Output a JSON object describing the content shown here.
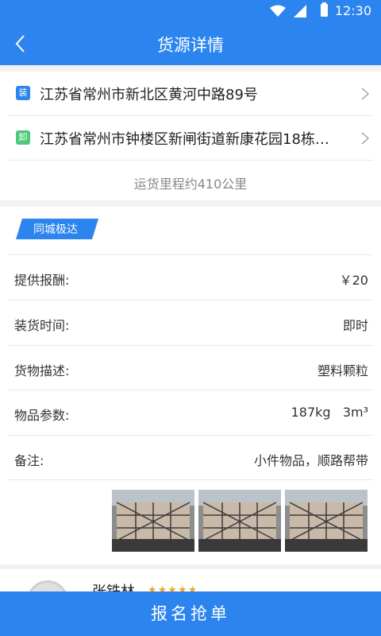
{
  "status_bar": {
    "time": "12:30",
    "icons": [
      "wifi-icon",
      "signal-icon",
      "battery-icon"
    ]
  },
  "header": {
    "title": "货源详情",
    "back_icon": "chevron-left-icon"
  },
  "route": {
    "load_tag": "装",
    "load_tag_color": "#2c84ee",
    "load_address": "江苏省常州市新北区黄河中路89号",
    "unload_tag": "卸",
    "unload_tag_color": "#4cc97a",
    "unload_address": "江苏省常州市钟楼区新闸街道新康花园18栋…",
    "mileage": "运货里程约410公里"
  },
  "detail": {
    "badge": "同城极达",
    "rows": [
      {
        "label": "提供报酬:",
        "value": "￥20"
      },
      {
        "label": "装货时间:",
        "value": "即时"
      },
      {
        "label": "货物描述:",
        "value": "塑料颗粒"
      },
      {
        "label": "物品参数:",
        "value": "187kg   3m³"
      },
      {
        "label": "备注:",
        "value": "小件物品，顺路帮带"
      }
    ],
    "photos": [
      "cargo-photo",
      "cargo-photo",
      "cargo-photo"
    ]
  },
  "shipper": {
    "name": "张铁林",
    "stars": "★★★★★"
  },
  "actions": {
    "submit_label": "报名抢单"
  },
  "colors": {
    "primary": "#2c84ee",
    "star": "#f5a623"
  }
}
